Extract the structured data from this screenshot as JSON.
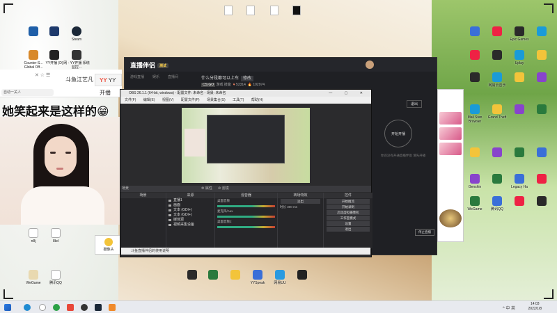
{
  "desktop": {
    "left_icons_top": [
      "",
      "",
      "Steam"
    ],
    "left_icons_row2": [
      "Counter-S... Global Off...",
      "YY开播 (D)",
      "网 - YY开播 系统监控..."
    ],
    "left_icons_bottom": [
      "n8j",
      "8kd"
    ],
    "left_icons_bottom2": [
      "WeGame",
      "腾讯QQ"
    ],
    "right_icons": [
      [
        "",
        "",
        "Epic Games",
        ""
      ],
      [
        "",
        "",
        "Uplay",
        ""
      ],
      [
        "",
        "网易云音乐",
        "",
        ""
      ],
      [
        "Mail Stan Browser",
        "Grand Theft",
        "",
        ""
      ],
      [
        "",
        "",
        "",
        ""
      ],
      [
        "Genshin",
        "",
        "Legacy Ha",
        ""
      ],
      [
        "WeGame",
        "腾讯QQ",
        "",
        ""
      ]
    ],
    "taskbar_icons": [
      "",
      "OBS 64bit",
      "直播伴侣",
      "YYSpeak",
      "网易UU",
      "Steam"
    ],
    "bottom_row_icons": [
      "YYSpeak",
      "网易UU",
      "",
      "",
      "",
      ""
    ]
  },
  "browser": {
    "tab_douyu": "斗鱼江艺凡",
    "tab_yy": "YY开播",
    "address": "自动一关人",
    "icons": "✕ ☆ ☰"
  },
  "overlay_caption": "她笑起来是这样的😁",
  "obs_mini": {
    "label": "摄像头"
  },
  "companion": {
    "logo": "直播伴侣",
    "badge": "测试",
    "nav": [
      "游戏直播",
      "娱乐",
      "直播间"
    ],
    "stream_title": "什么分段都可以上车",
    "edit_label": "修改",
    "rate": "CS:GO",
    "category": "游戏 技能",
    "viewers": "52314",
    "hot": "102974",
    "exit_label": "退出",
    "start_label": "开始开播",
    "tip": "你还没有开通直播伴侣 请先开播",
    "stop_label": "停止直播"
  },
  "obs": {
    "title": "OBS 26.1.1 (64-bit, windows) - 配置文件: 未命名 - 场景: 未命名",
    "window_controls": "— ▢ ✕",
    "menu": [
      "文件(F)",
      "编辑(E)",
      "视图(V)",
      "配置文件(P)",
      "场景集合(S)",
      "工具(T)",
      "帮助(H)"
    ],
    "dock_labels": {
      "scenes": "场景",
      "sources": "来源",
      "mixer": "混音器",
      "transitions": "转场特效",
      "controls": "控件"
    },
    "preview_bar": [
      "⚙ 属性",
      "⊘ 滤镜"
    ],
    "sources": [
      "直播1",
      "画面",
      "文本 (GDI+)",
      "文本 (GDI+)",
      "媒体源",
      "视频采集设备"
    ],
    "mixer_rows": [
      "桌面音频",
      "麦克风/Aux",
      "桌面音频2"
    ],
    "transition": "淡出",
    "duration_label": "时长",
    "duration": "300 ms",
    "controls": [
      "开始推流",
      "开始录制",
      "启动虚拟摄像机",
      "工作室模式",
      "设置",
      "退出"
    ],
    "status": [
      "LIVE: 00:00:00",
      "REC: 00:00:00",
      "CPU: 3.6%, 60.00 fps"
    ],
    "footer": "斗鱼直播伴侣的使用说明"
  },
  "taskbar": {
    "time": "14:03",
    "date": "2022/1/8",
    "tray": "^ 中 英"
  }
}
